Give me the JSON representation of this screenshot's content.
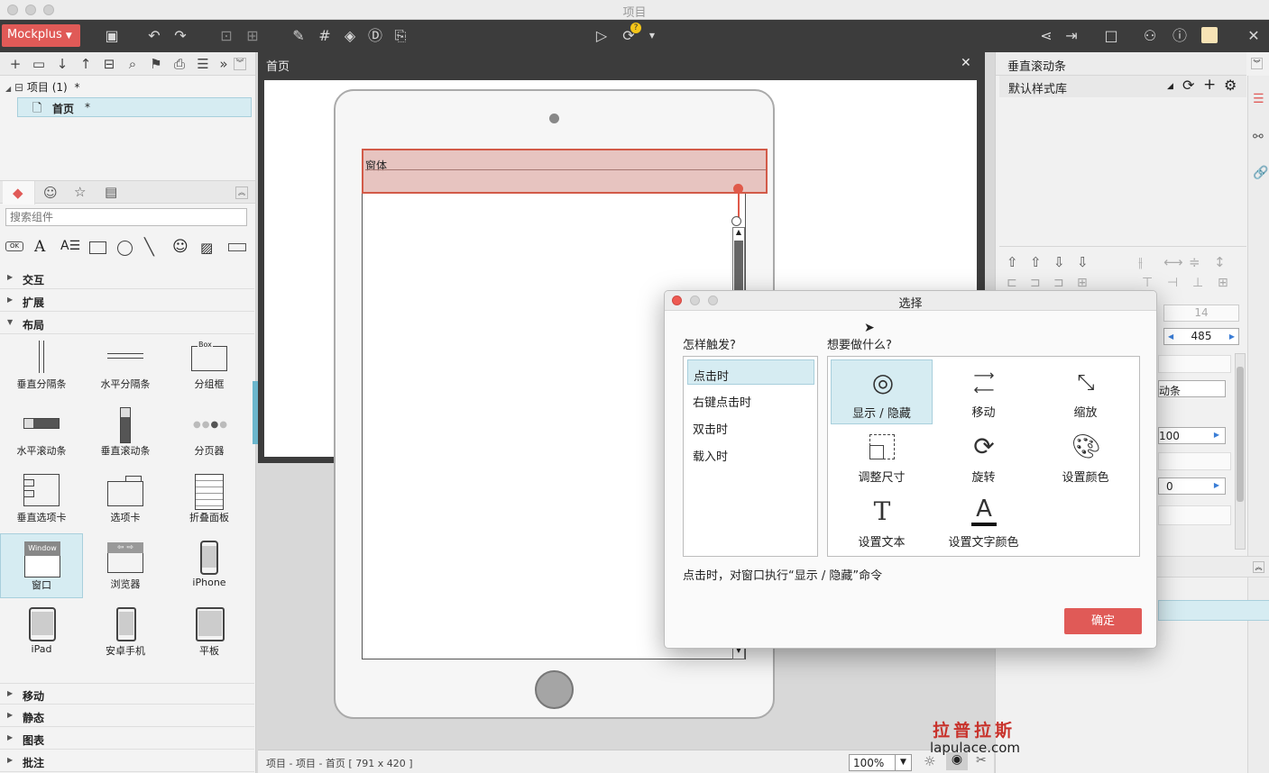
{
  "window_title": "项目",
  "toolbar": {
    "brand": "Mockplus"
  },
  "project_tree": {
    "project_label": "项目 (1)",
    "project_mark": "*",
    "page_label": "首页",
    "page_mark": "*"
  },
  "component_search": {
    "placeholder": "搜索组件"
  },
  "categories": [
    "交互",
    "扩展",
    "布局"
  ],
  "layout_components": [
    {
      "label": "垂直分隔条"
    },
    {
      "label": "水平分隔条"
    },
    {
      "label": "分组框"
    },
    {
      "label": "水平滚动条"
    },
    {
      "label": "垂直滚动条"
    },
    {
      "label": "分页器"
    },
    {
      "label": "垂直选项卡"
    },
    {
      "label": "选项卡"
    },
    {
      "label": "折叠面板"
    },
    {
      "label": "窗口"
    },
    {
      "label": "浏览器"
    },
    {
      "label": "iPhone"
    },
    {
      "label": "iPad"
    },
    {
      "label": "安卓手机"
    },
    {
      "label": "平板"
    }
  ],
  "group_box_text": "Box",
  "window_icon_text": "Window",
  "bottom_categories": [
    "移动",
    "静态",
    "图表",
    "批注"
  ],
  "canvas": {
    "tab_title": "首页",
    "window_widget_label": "窗体"
  },
  "status": {
    "breadcrumb": "项目 - 项目 - 首页 [ 791 x 420 ]",
    "zoom": "100%"
  },
  "right_panel": {
    "title": "垂直滚动条",
    "style_lib": "默认样式库",
    "field_14": "14",
    "field_485": "485",
    "field_name_partial": "动条",
    "field_100": "100",
    "field_0": "0"
  },
  "dialog": {
    "title": "选择",
    "trigger_heading": "怎样触发?",
    "action_heading": "想要做什么?",
    "triggers": [
      "点击时",
      "右键点击时",
      "双击时",
      "载入时"
    ],
    "actions": [
      {
        "label": "显示 / 隐藏",
        "icon": "eye-icon"
      },
      {
        "label": "移动",
        "icon": "move-arrows-icon"
      },
      {
        "label": "缩放",
        "icon": "scale-icon"
      },
      {
        "label": "调整尺寸",
        "icon": "resize-icon"
      },
      {
        "label": "旋转",
        "icon": "rotate-icon"
      },
      {
        "label": "设置颜色",
        "icon": "palette-icon"
      },
      {
        "label": "设置文本",
        "icon": "text-icon"
      },
      {
        "label": "设置文字颜色",
        "icon": "text-color-icon"
      }
    ],
    "description": "点击时，对窗口执行“显示 / 隐藏”命令",
    "confirm": "确定"
  },
  "watermark": {
    "cn": "拉普拉斯",
    "url": "lapulace.com"
  },
  "colors": {
    "brand": "#e05a57",
    "accent_select": "#d6ecf2",
    "confirm": "#e05a57"
  }
}
